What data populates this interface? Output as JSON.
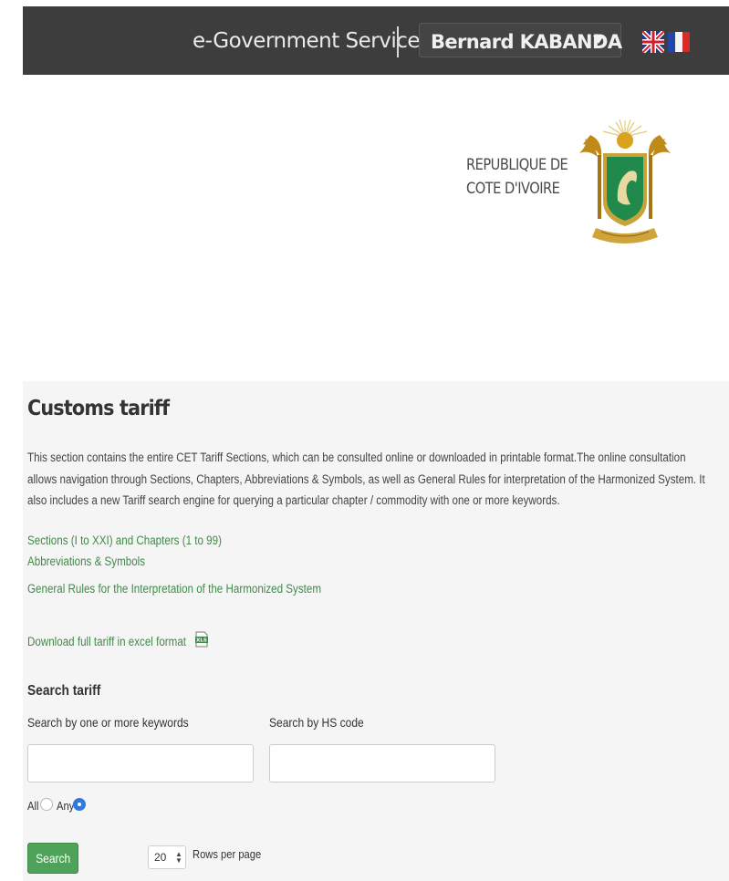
{
  "header": {
    "title": "e-Government Services",
    "user_name": "Bernard KABANDA",
    "languages": [
      {
        "code": "en",
        "icon": "uk-flag-icon"
      },
      {
        "code": "fr",
        "icon": "france-flag-icon"
      }
    ]
  },
  "logo": {
    "line1": "REPUBLIQUE DE",
    "line2": "COTE D'IVOIRE",
    "emblem_icon": "coat-of-arms-icon"
  },
  "main": {
    "title": "Customs tariff",
    "intro": "This section contains the entire CET Tariff Sections, which can be consulted online or downloaded in printable format.The online consultation allows navigation through Sections, Chapters, Abbreviations & Symbols, as well as General Rules for interpretation of the Harmonized System. It also includes a new Tariff search engine for querying a particular chapter / commodity with one or more keywords.",
    "links": [
      "Sections (I to XXI) and Chapters (1 to 99)",
      "Abbreviations & Symbols",
      "General Rules for the Interpretation of the Harmonized System"
    ],
    "download_label": "Download full tariff in excel format",
    "download_icon": "xls-file-icon"
  },
  "search": {
    "title": "Search tariff",
    "keywords_label": "Search by one or more keywords",
    "keywords_value": "",
    "hs_label": "Search by HS code",
    "hs_value": "",
    "radio_all": "All",
    "radio_any": "Any",
    "selected": "Any",
    "button": "Search",
    "rows_value": "20",
    "rows_label": "Rows per page"
  },
  "colors": {
    "topbar": "#3d3d3d",
    "link": "#3f8a47",
    "button": "#4fa25a",
    "radio_selected": "#2f7bdd",
    "panel": "#f5f5f5"
  }
}
